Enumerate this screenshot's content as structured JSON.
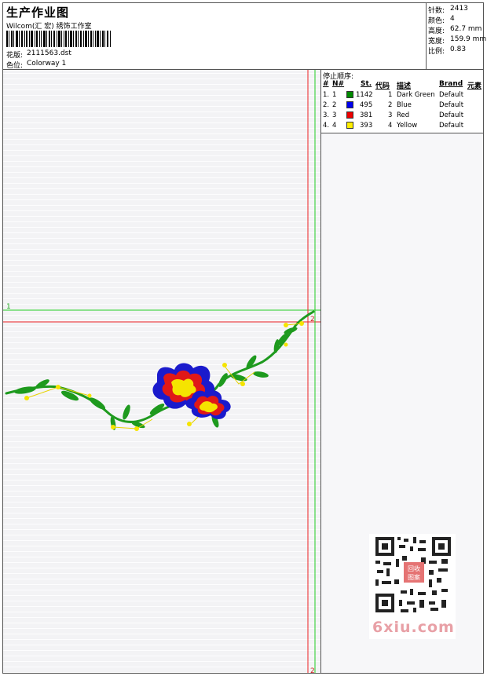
{
  "header": {
    "title": "生产作业图",
    "studio": "Wilcom(汇 宏) 绣饰工作室",
    "design_label": "花版:",
    "design_file": "2111563.dst",
    "colorway_label": "色位:",
    "colorway_name": "Colorway 1"
  },
  "stats": [
    {
      "label": "针数:",
      "value": "2413"
    },
    {
      "label": "颜色:",
      "value": "4"
    },
    {
      "label": "高度:",
      "value": "62.7 mm"
    },
    {
      "label": "宽度:",
      "value": "159.9 mm"
    },
    {
      "label": "比例:",
      "value": "0.83"
    }
  ],
  "guides": {
    "marker_1": "1",
    "marker_2_top": "2",
    "marker_2_bottom": "2",
    "green": "#22cc22",
    "red": "#ee2222"
  },
  "stop_sequence": {
    "heading": "停止顺序:",
    "columns": [
      "#",
      "N#",
      "St.",
      "代码",
      "描述",
      "Brand",
      "元素"
    ],
    "rows": [
      {
        "num": "1.",
        "n": "1",
        "color": "#008a00",
        "stitches": "1142",
        "code": "1",
        "desc": "Dark Green",
        "brand": "Default"
      },
      {
        "num": "2.",
        "n": "2",
        "color": "#0000ee",
        "stitches": "495",
        "code": "2",
        "desc": "Blue",
        "brand": "Default"
      },
      {
        "num": "3.",
        "n": "3",
        "color": "#ee0000",
        "stitches": "381",
        "code": "3",
        "desc": "Red",
        "brand": "Default"
      },
      {
        "num": "4.",
        "n": "4",
        "color": "#ffee00",
        "stitches": "393",
        "code": "4",
        "desc": "Yellow",
        "brand": "Default"
      }
    ]
  },
  "embroidery": {
    "green": "#1e9a1e",
    "blue": "#1a1acc",
    "red": "#e01818",
    "yellow": "#f5e400"
  },
  "watermark": {
    "text": "6xiu.com",
    "stamp_line1": "回收",
    "stamp_line2": "图案"
  }
}
